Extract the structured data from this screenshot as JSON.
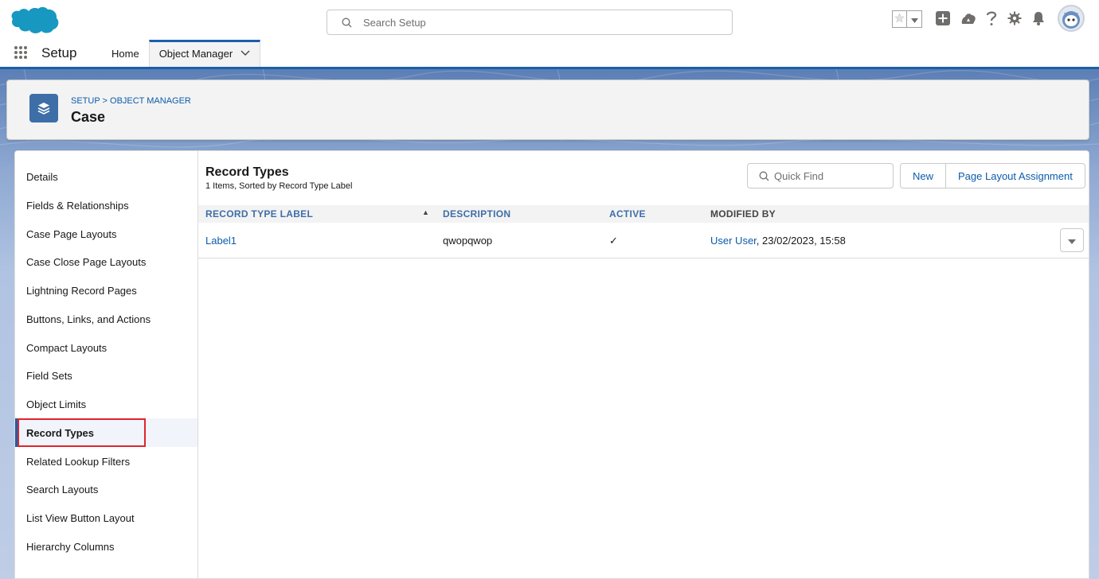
{
  "header": {
    "search_placeholder": "Search Setup"
  },
  "nav": {
    "app_name": "Setup",
    "items": [
      {
        "label": "Home"
      },
      {
        "label": "Object Manager"
      }
    ]
  },
  "object": {
    "breadcrumb": "SETUP > OBJECT MANAGER",
    "title": "Case"
  },
  "sidebar": {
    "items": [
      {
        "label": "Details"
      },
      {
        "label": "Fields & Relationships"
      },
      {
        "label": "Case Page Layouts"
      },
      {
        "label": "Case Close Page Layouts"
      },
      {
        "label": "Lightning Record Pages"
      },
      {
        "label": "Buttons, Links, and Actions"
      },
      {
        "label": "Compact Layouts"
      },
      {
        "label": "Field Sets"
      },
      {
        "label": "Object Limits"
      },
      {
        "label": "Record Types"
      },
      {
        "label": "Related Lookup Filters"
      },
      {
        "label": "Search Layouts"
      },
      {
        "label": "List View Button Layout"
      },
      {
        "label": "Hierarchy Columns"
      }
    ],
    "selected": "Record Types"
  },
  "main": {
    "title": "Record Types",
    "subtitle": "1 Items, Sorted by Record Type Label",
    "quick_find_placeholder": "Quick Find",
    "new_label": "New",
    "page_layout_assignment_label": "Page Layout Assignment",
    "columns": [
      "RECORD TYPE LABEL",
      "DESCRIPTION",
      "ACTIVE",
      "MODIFIED BY"
    ],
    "rows": [
      {
        "label": "Label1",
        "description": "qwopqwop",
        "active": "✓",
        "modified_by_user": "User User",
        "modified_by_date": ", 23/02/2023, 15:58"
      }
    ]
  },
  "colors": {
    "brand": "#1b5fa8",
    "link": "#0b5cab",
    "highlight": "#e0242f"
  }
}
